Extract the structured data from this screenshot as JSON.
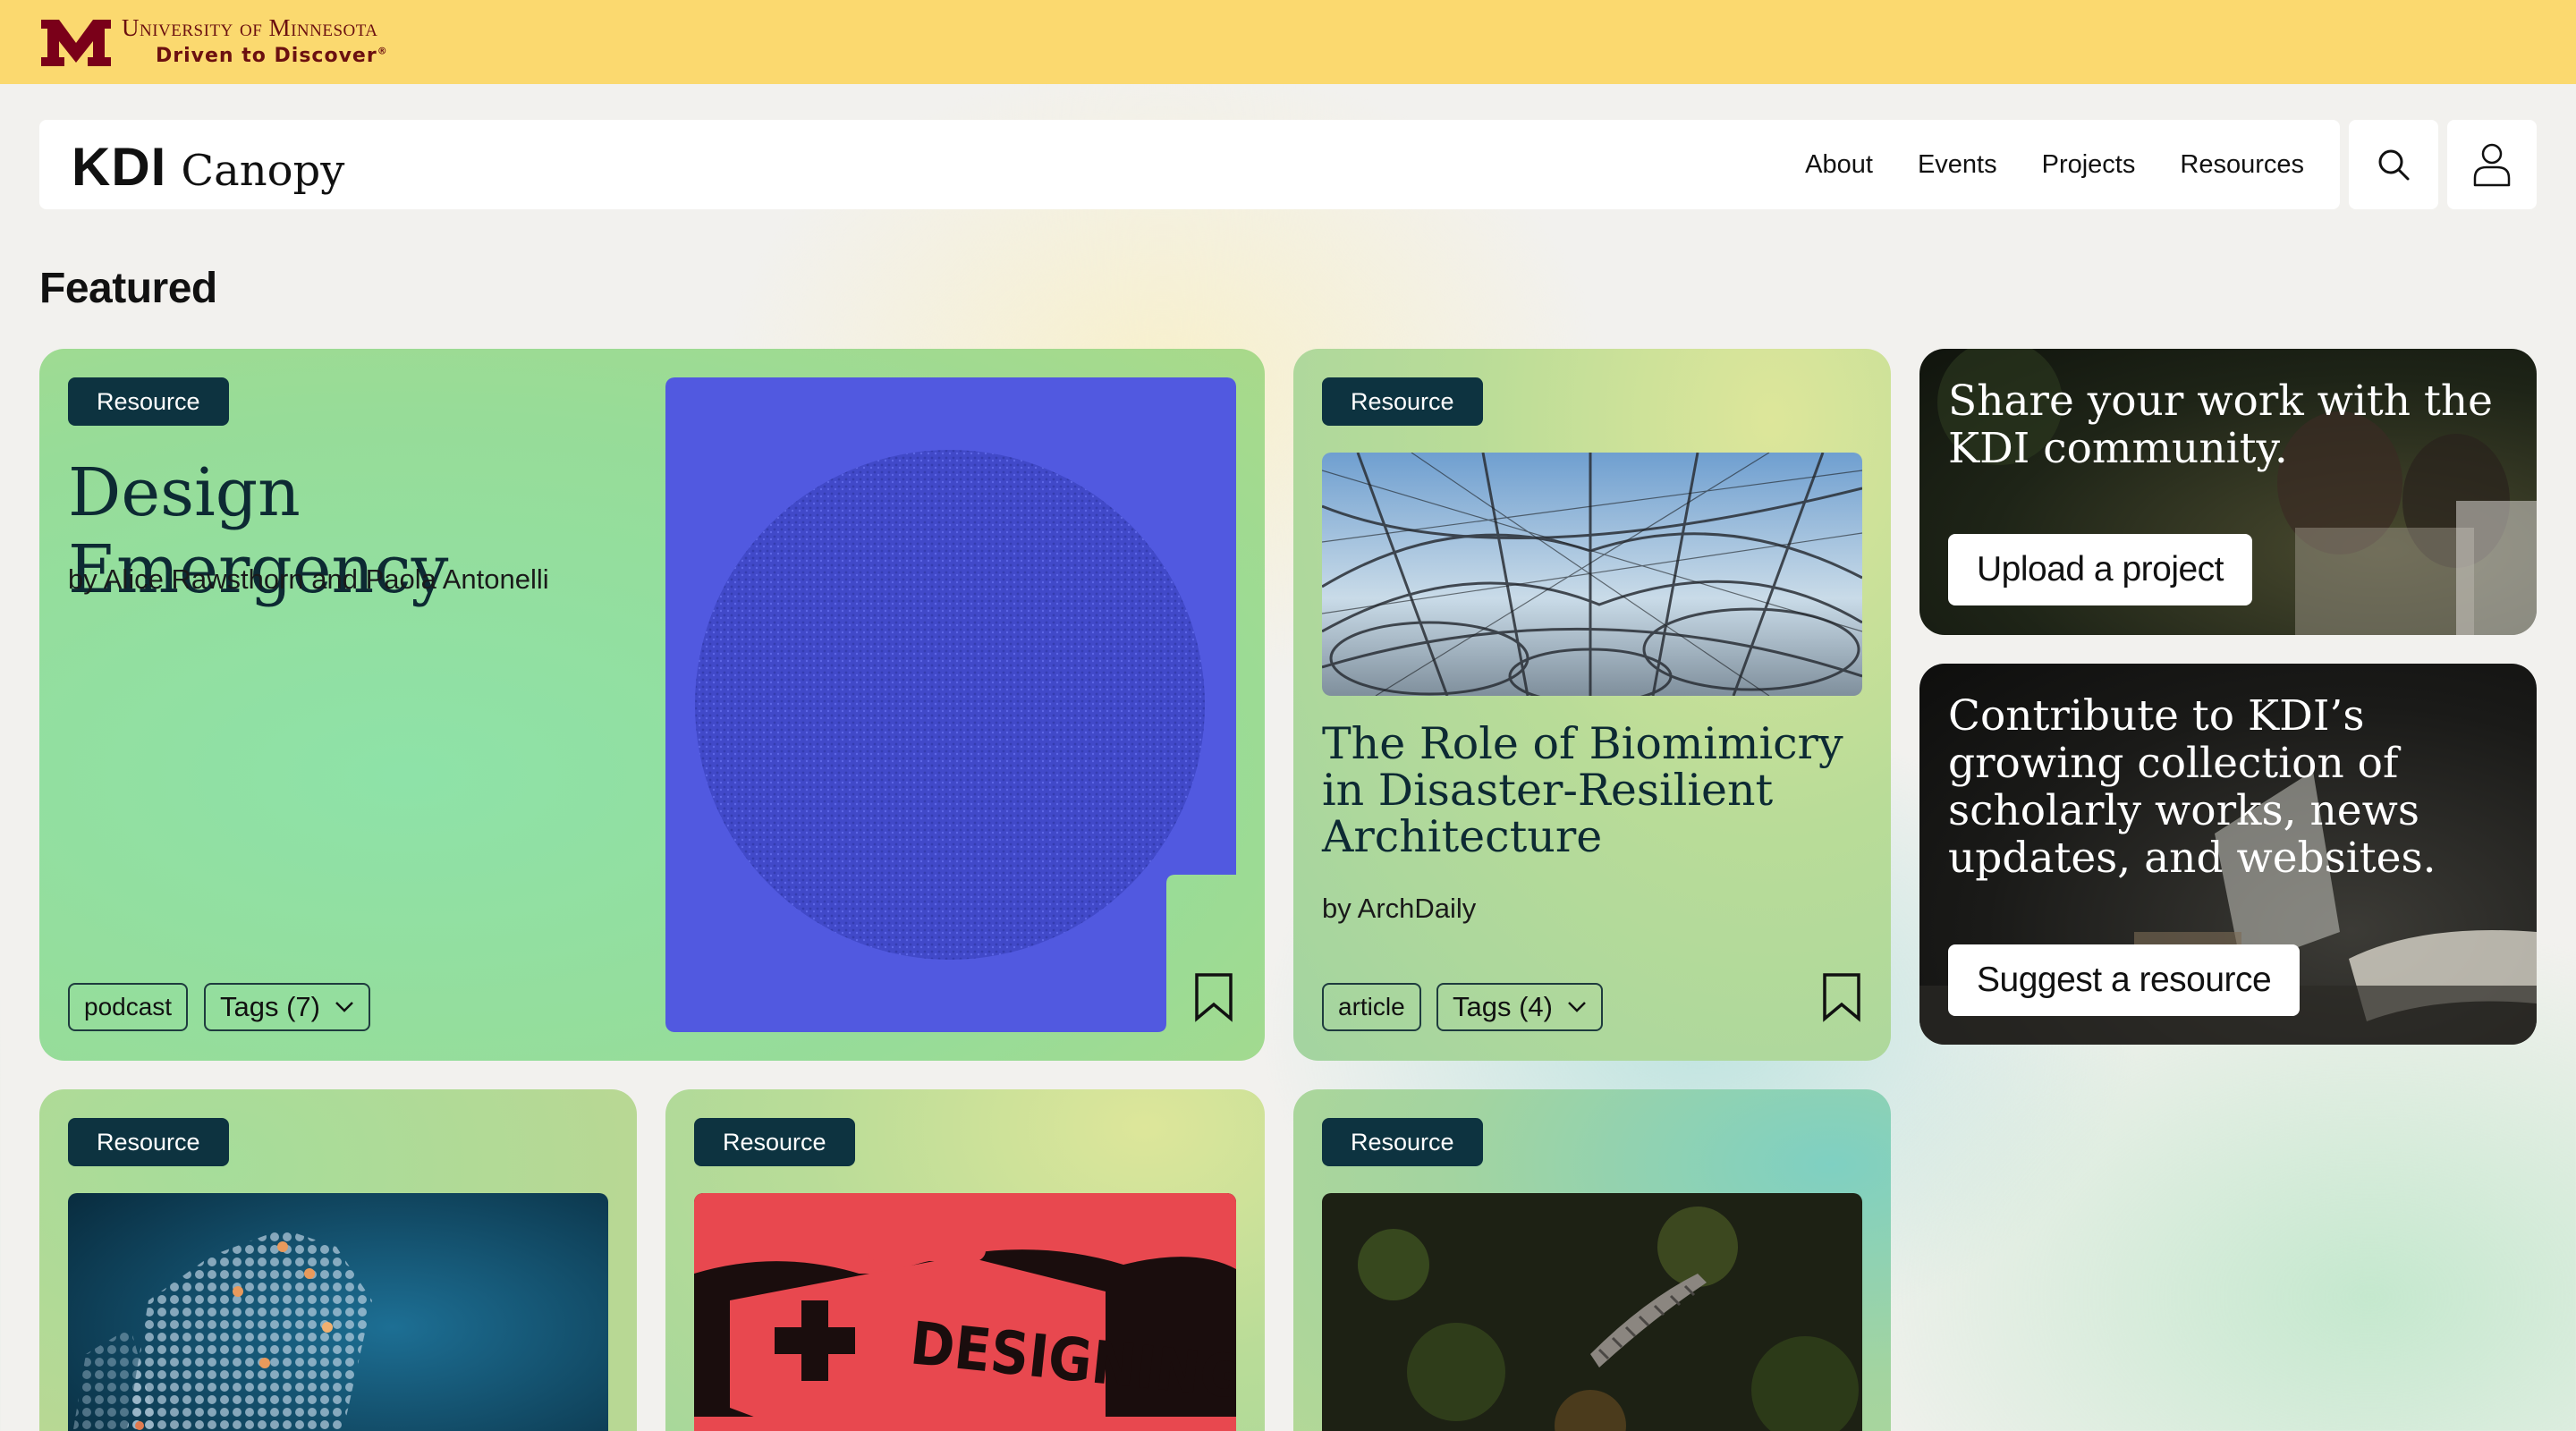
{
  "umn": {
    "name": "University of Minnesota",
    "tagline": "Driven to Discover",
    "tagline_mark": "®"
  },
  "header": {
    "brand_primary": "KDI",
    "brand_secondary": "Canopy",
    "nav": [
      "About",
      "Events",
      "Projects",
      "Resources"
    ],
    "search_icon": "search-icon",
    "account_icon": "user-icon"
  },
  "featured": {
    "heading": "Featured",
    "cards": [
      {
        "badge": "Resource",
        "title": "Design Emergency",
        "byline": "by Alice Rawsthorn and Paola Antonelli",
        "type_chip": "podcast",
        "tags_chip": "Tags (7)"
      },
      {
        "badge": "Resource",
        "title": "The Role of Biomimicry in Disaster-Resilient Architecture",
        "byline": "by ArchDaily",
        "type_chip": "article",
        "tags_chip": "Tags (4)"
      },
      {
        "badge": "Resource"
      },
      {
        "badge": "Resource",
        "image_text": "DESIGNING FOR DISASTER"
      },
      {
        "badge": "Resource"
      }
    ]
  },
  "promos": {
    "share_text": "Share your work with the KDI community.",
    "share_button": "Upload a project",
    "contribute_text": "Contribute to KDI’s growing collection of scholarly works, news updates, and websites.",
    "contribute_button": "Suggest a resource"
  },
  "colors": {
    "umn_gold": "#fbd96f",
    "umn_maroon": "#7a0019",
    "badge_bg": "#0d3340",
    "podcast_art": "#5159e0"
  }
}
